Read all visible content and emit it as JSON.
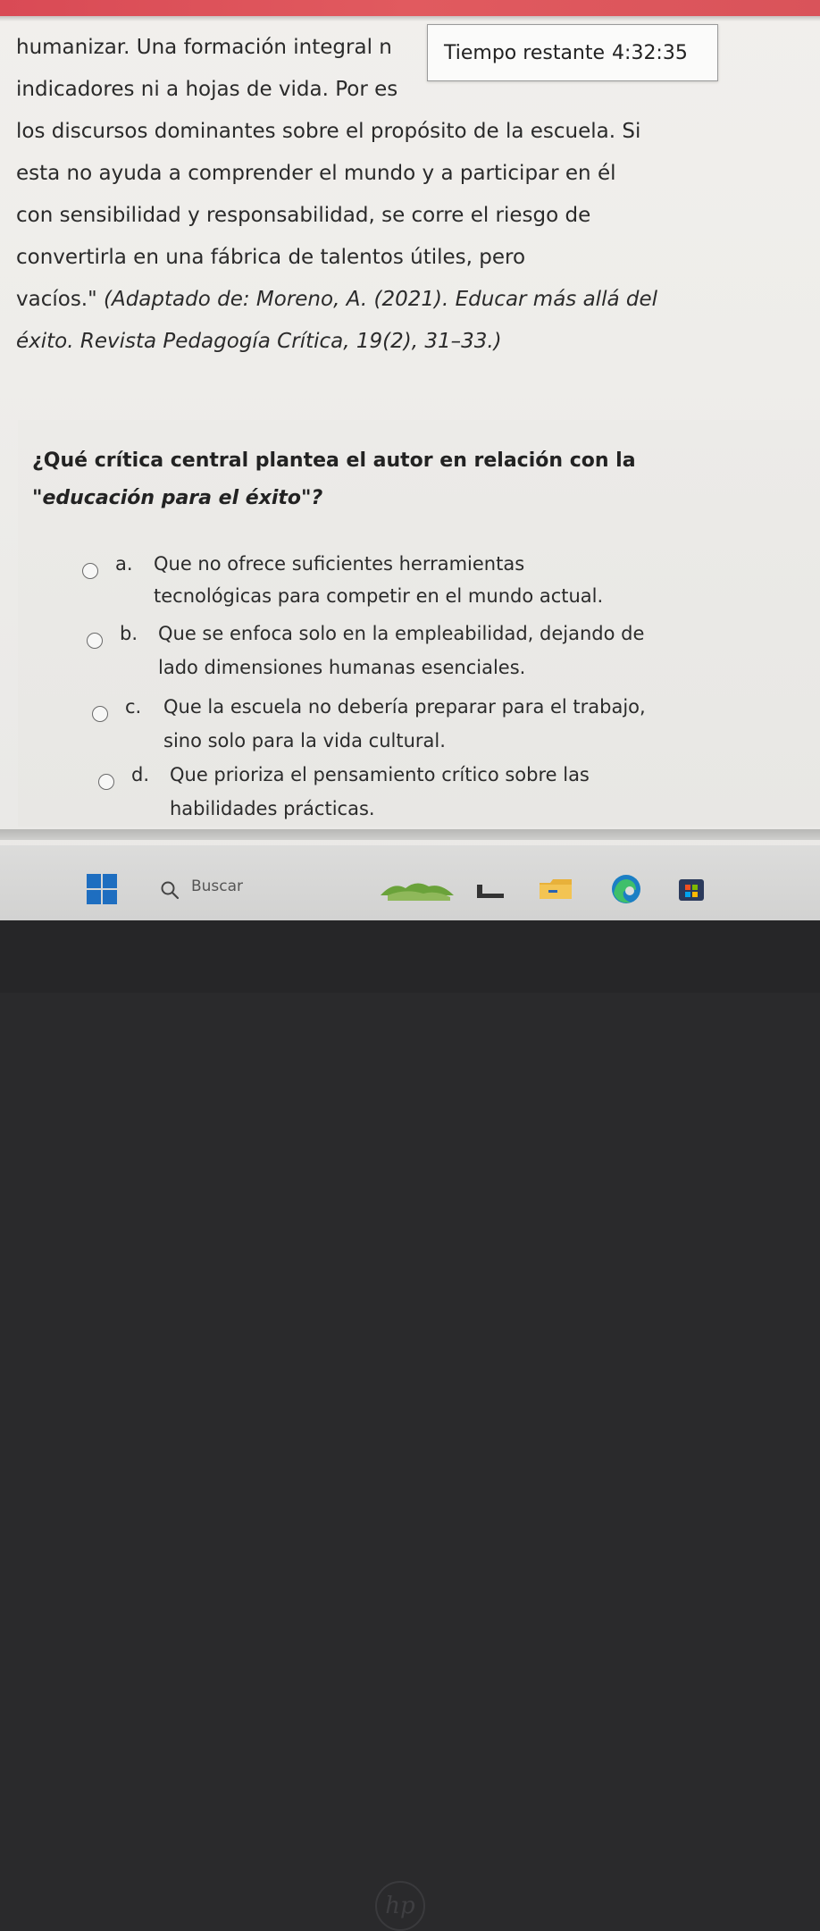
{
  "timer": {
    "label": "Tiempo restante",
    "value": "4:32:35"
  },
  "passage": {
    "lines": [
      "humanizar. Una formación integral n",
      "indicadores ni a hojas de vida. Por es",
      "los discursos dominantes sobre el propósito de la escuela. Si",
      "esta no ayuda a comprender el mundo y a participar en él",
      "con sensibilidad y responsabilidad, se corre el riesgo de",
      "convertirla en una fábrica de talentos útiles, pero"
    ],
    "line7_plain": "vacíos.\" ",
    "line7_italic": "(Adaptado de: Moreno, A. (2021). Educar más allá del",
    "line8_italic": "éxito. Revista Pedagogía Crítica, 19(2), 31–33.)"
  },
  "question": {
    "line1": "¿Qué crítica central plantea el autor en relación con la",
    "line2": "\"educación para el éxito\"?"
  },
  "options": [
    {
      "letter": "a.",
      "line1": "Que no ofrece suficientes herramientas",
      "line2": "tecnológicas para competir en el mundo actual."
    },
    {
      "letter": "b.",
      "line1": "Que se enfoca solo en la empleabilidad, dejando de",
      "line2": "lado dimensiones humanas esenciales."
    },
    {
      "letter": "c.",
      "line1": "Que la escuela no debería preparar para el trabajo,",
      "line2": "sino solo para la vida cultural."
    },
    {
      "letter": "d.",
      "line1": "Que prioriza el pensamiento crítico sobre las",
      "line2": "habilidades prácticas."
    }
  ],
  "taskbar": {
    "search_label": "Buscar",
    "icons": [
      "windows-start-icon",
      "search-icon",
      "widget-landscape-icon",
      "file-explorer-icon",
      "folder-icon",
      "edge-browser-icon",
      "store-icon"
    ]
  },
  "colors": {
    "top_strip": "#d94a55",
    "windows_blue": "#1e6ec0",
    "edge_blue": "#1b7fc4",
    "edge_green": "#3fbf6a"
  }
}
